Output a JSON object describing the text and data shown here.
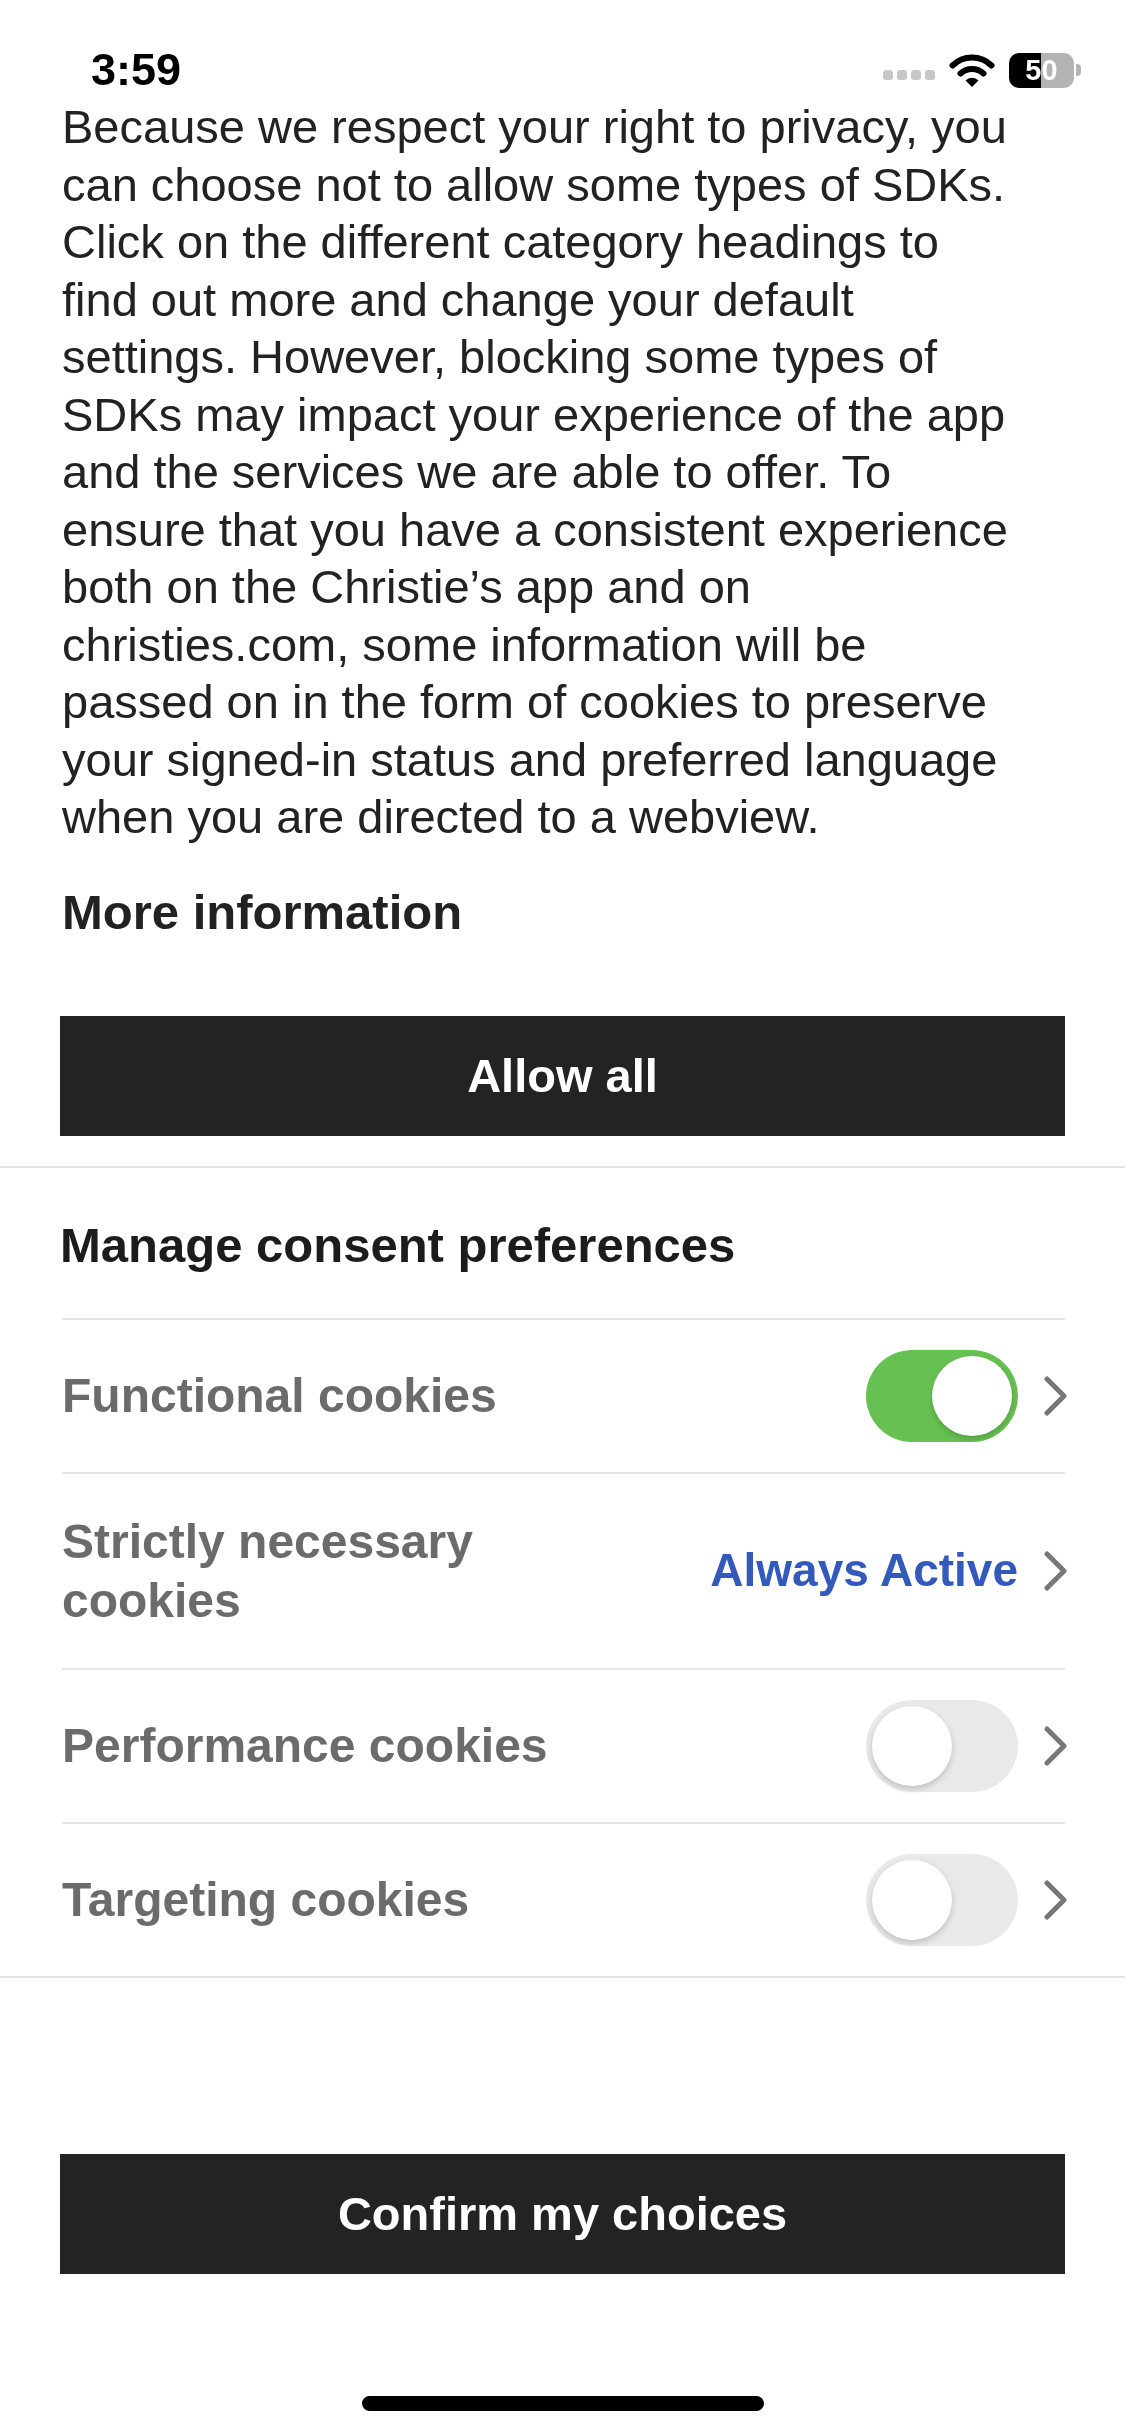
{
  "status_bar": {
    "time": "3:59",
    "battery": "50"
  },
  "intro": {
    "text": "Because we respect your right to privacy, you can choose not to allow some types of SDKs. Click on the different category headings to find out more and change your default settings. However, blocking some types of SDKs may impact your experience of the app and the services we are able to offer. To ensure that you have a consistent experience both on the Christie’s app and on christies.com, some information will be passed on in the form of cookies to preserve your signed-in status and preferred language when you are directed to a webview.",
    "more_information": "More information"
  },
  "allow_all_button": {
    "label": "Allow all"
  },
  "preferences": {
    "title": "Manage consent preferences",
    "items": [
      {
        "label": "Functional cookies",
        "kind": "toggle",
        "on": true
      },
      {
        "label": "Strictly necessary cookies",
        "kind": "status",
        "status": "Always Active"
      },
      {
        "label": "Performance cookies",
        "kind": "toggle",
        "on": false
      },
      {
        "label": "Targeting cookies",
        "kind": "toggle",
        "on": false
      }
    ]
  },
  "confirm_button": {
    "label": "Confirm my choices"
  }
}
